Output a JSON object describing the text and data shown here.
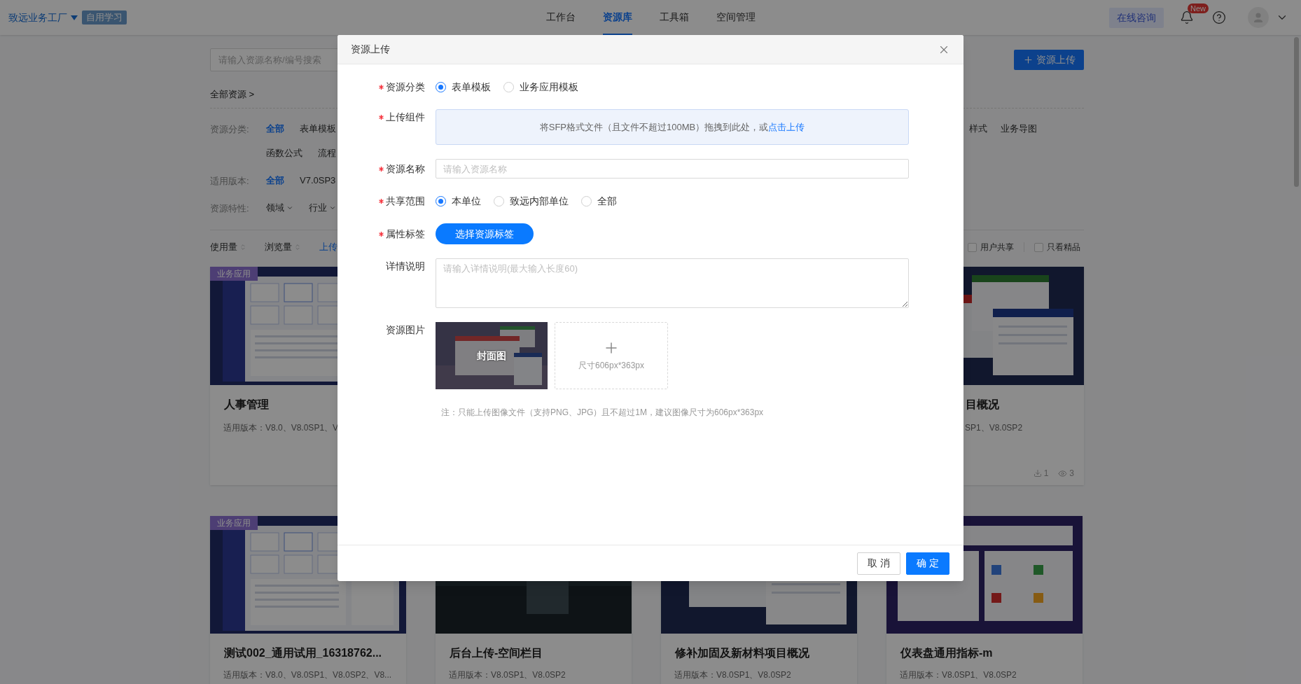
{
  "header": {
    "brand": "致远业务工厂",
    "badge": "自用学习",
    "nav": [
      {
        "label": "工作台",
        "selected": false
      },
      {
        "label": "资源库",
        "selected": true
      },
      {
        "label": "工具箱",
        "selected": false
      },
      {
        "label": "空间管理",
        "selected": false
      }
    ],
    "consult_button": "在线咨询",
    "notification_badge": "New"
  },
  "search": {
    "placeholder": "请输入资源名称/编号搜索"
  },
  "upload_button": "资源上传",
  "breadcrumb": "全部资源 >",
  "filters": [
    {
      "kind": "options",
      "label": "资源分类:",
      "lines": [
        {
          "left": [
            {
              "label": "全部",
              "selected": true
            },
            {
              "label": "表单模板",
              "selected": false
            }
          ],
          "right": [
            {
              "label": "样式",
              "selected": false
            },
            {
              "label": "业务导图",
              "selected": false
            }
          ]
        },
        {
          "left": [
            {
              "label": "函数公式",
              "selected": false
            },
            {
              "label": "流程",
              "selected": false
            }
          ]
        }
      ]
    },
    {
      "kind": "options",
      "label": "适用版本:",
      "lines": [
        {
          "left": [
            {
              "label": "全部",
              "selected": true
            },
            {
              "label": "V7.0SP3",
              "selected": false
            }
          ]
        }
      ]
    },
    {
      "kind": "dropdowns",
      "label": "资源特性:",
      "lines": [
        {
          "left": [
            {
              "label": "领域"
            },
            {
              "label": "行业"
            }
          ]
        }
      ]
    }
  ],
  "sort": [
    {
      "kind": "sortable",
      "label": "使用量",
      "selected": false
    },
    {
      "kind": "sortable",
      "label": "浏览量",
      "selected": false
    },
    {
      "kind": "plain",
      "label": "上传",
      "selected": true
    }
  ],
  "checkboxes": [
    {
      "label": "用户共享",
      "checked": false
    },
    {
      "label": "只看精品",
      "checked": false
    }
  ],
  "cards_row_1": [
    {
      "kind": "screenshot",
      "tag": "业务应用",
      "title": "人事管理",
      "versions": "适用版本：V8.0、V8.0SP1、V"
    },
    {
      "kind": "windows",
      "title": "目概况",
      "versions": "SP1、V8.0SP2",
      "stats": [
        {
          "kind": "downloads",
          "value": "1"
        },
        {
          "kind": "views",
          "value": "3"
        }
      ]
    }
  ],
  "cards_row_2": [
    {
      "kind": "screenshot",
      "tag": "业务应用",
      "title": "测试002_通用试用_16318762...",
      "versions": "适用版本：V8.0、V8.0SP1、V8.0SP2、V8..."
    },
    {
      "kind": "photo",
      "title": "后台上传-空间栏目",
      "versions": "适用版本：V8.0SP1、V8.0SP2"
    },
    {
      "kind": "windows",
      "title": "修补加固及新材料项目概况",
      "versions": "适用版本：V8.0SP1、V8.0SP2"
    },
    {
      "kind": "dashboard",
      "title": "仪表盘通用指标-m",
      "versions": "适用版本：V8.0SP1、V8.0SP2"
    }
  ],
  "dialog": {
    "title": "资源上传",
    "fields": [
      {
        "kind": "radio",
        "label": "资源分类",
        "required": true,
        "options": [
          {
            "label": "表单模板",
            "selected": true
          },
          {
            "label": "业务应用模板",
            "selected": false
          }
        ]
      },
      {
        "kind": "dropzone",
        "label": "上传组件",
        "required": true,
        "text": "将SFP格式文件（且文件不超过100MB）拖拽到此处，或",
        "link": "点击上传"
      },
      {
        "kind": "input",
        "label": "资源名称",
        "required": true,
        "placeholder": "请输入资源名称"
      },
      {
        "kind": "radio",
        "label": "共享范围",
        "required": true,
        "options": [
          {
            "label": "本单位",
            "selected": true
          },
          {
            "label": "致远内部单位",
            "selected": false
          },
          {
            "label": "全部",
            "selected": false
          }
        ]
      },
      {
        "kind": "button",
        "label": "属性标签",
        "required": true,
        "button": "选择资源标签"
      },
      {
        "kind": "textarea",
        "label": "详情说明",
        "required": false,
        "placeholder": "请输入详情说明(最大输入长度60)"
      },
      {
        "kind": "images",
        "label": "资源图片",
        "required": false,
        "cover": "封面图",
        "upload_hint": "尺寸606px*363px"
      }
    ],
    "note": "注：只能上传图像文件（支持PNG、JPG）且不超过1M，建议图像尺寸为606px*363px",
    "buttons": [
      {
        "label": "取 消",
        "primary": false
      },
      {
        "label": "确 定",
        "primary": true
      }
    ]
  }
}
